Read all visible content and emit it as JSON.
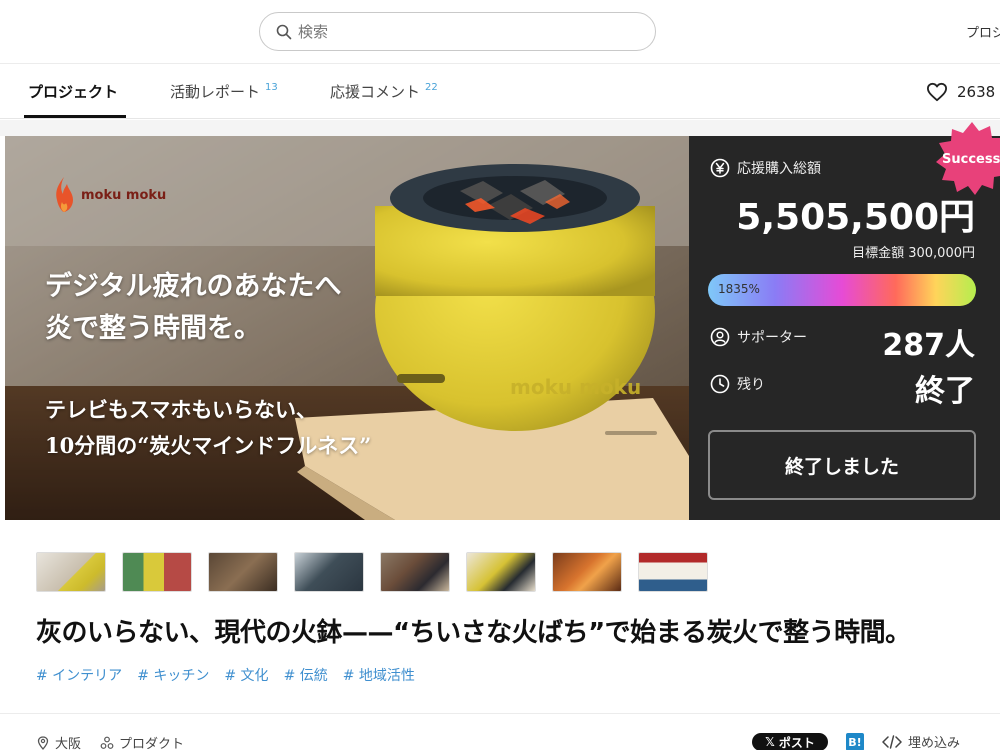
{
  "search": {
    "placeholder": "検索"
  },
  "header": {
    "right_label": "プロジ"
  },
  "tabs": [
    {
      "label": "プロジェクト",
      "count": ""
    },
    {
      "label": "活動レポート",
      "count": "13"
    },
    {
      "label": "応援コメント",
      "count": "22"
    }
  ],
  "likes": {
    "count": "2638"
  },
  "hero": {
    "brand": "moku moku",
    "headline_line1": "デジタル疲れのあなたへ",
    "headline_line2": "炎で整う時間を。",
    "sub_line1": "テレビもスマホもいらない、",
    "sub_line2": "10分間の“炭火マインドフルネス”"
  },
  "funding": {
    "total_label": "応援購入総額",
    "total_amount": "5,505,500円",
    "goal_text": "目標金額 300,000円",
    "progress_percent": 1835,
    "progress_label": "1835%",
    "supporters_label": "サポーター",
    "supporters_value": "287人",
    "remaining_label": "残り",
    "remaining_value": "終了",
    "ended_button": "終了しました",
    "success_badge": "Success!"
  },
  "colors": {
    "panel_bg": "#262626",
    "tag_blue": "#3f8fcf",
    "success_pink": "#e8417a"
  },
  "thumbnails": [
    "thumb-1",
    "thumb-2",
    "thumb-3",
    "thumb-4",
    "thumb-5",
    "thumb-6",
    "thumb-7",
    "thumb-8"
  ],
  "project": {
    "title": "灰のいらない、現代の火鉢——“ちいさな火ばち”で始まる炭火で整う時間。",
    "tags": [
      "# インテリア",
      "# キッチン",
      "# 文化",
      "# 伝統",
      "# 地域活性"
    ]
  },
  "meta": {
    "location": "大阪",
    "category": "プロダクト",
    "post_label": "ポスト",
    "hatena_label": "B!",
    "embed_label": "埋め込み"
  }
}
